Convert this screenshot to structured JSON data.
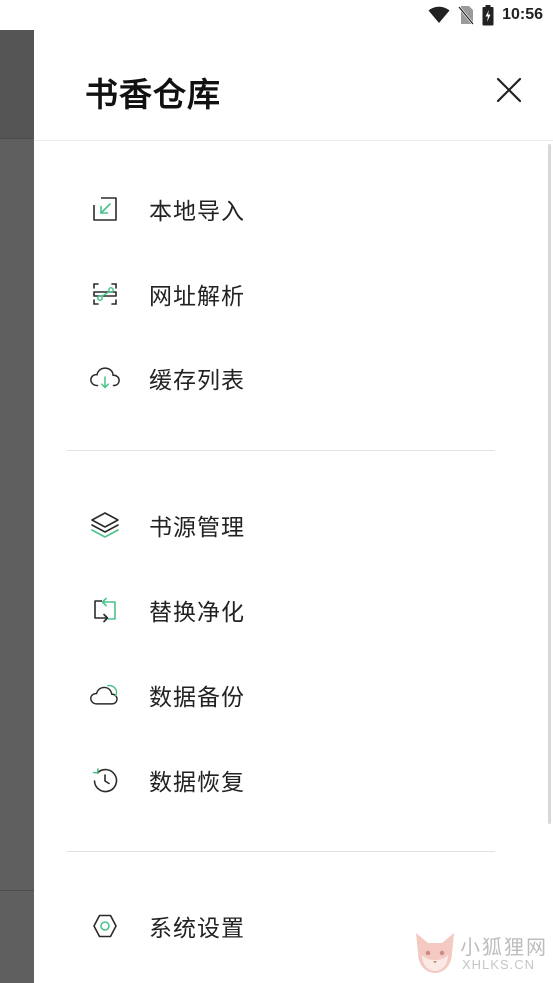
{
  "status_bar": {
    "time": "10:56",
    "icons": [
      "wifi-icon",
      "no-sim-icon",
      "battery-charging-icon"
    ]
  },
  "drawer": {
    "title": "书香仓库",
    "close_icon": "close-icon",
    "sections": [
      {
        "items": [
          {
            "label": "本地导入",
            "icon": "import-icon"
          },
          {
            "label": "网址解析",
            "icon": "link-parse-icon"
          },
          {
            "label": "缓存列表",
            "icon": "cloud-download-icon"
          }
        ]
      },
      {
        "items": [
          {
            "label": "书源管理",
            "icon": "layers-icon"
          },
          {
            "label": "替换净化",
            "icon": "replace-icon"
          },
          {
            "label": "数据备份",
            "icon": "cloud-backup-icon"
          },
          {
            "label": "数据恢复",
            "icon": "restore-icon"
          }
        ]
      },
      {
        "items": [
          {
            "label": "系统设置",
            "icon": "settings-icon"
          }
        ]
      }
    ]
  },
  "watermark": {
    "text": "小狐狸网",
    "sub": "XHLKS.CN"
  },
  "colors": {
    "accent": "#4cc38a",
    "icon_stroke": "#2b2b2b",
    "backdrop": "#5f5f5f"
  }
}
